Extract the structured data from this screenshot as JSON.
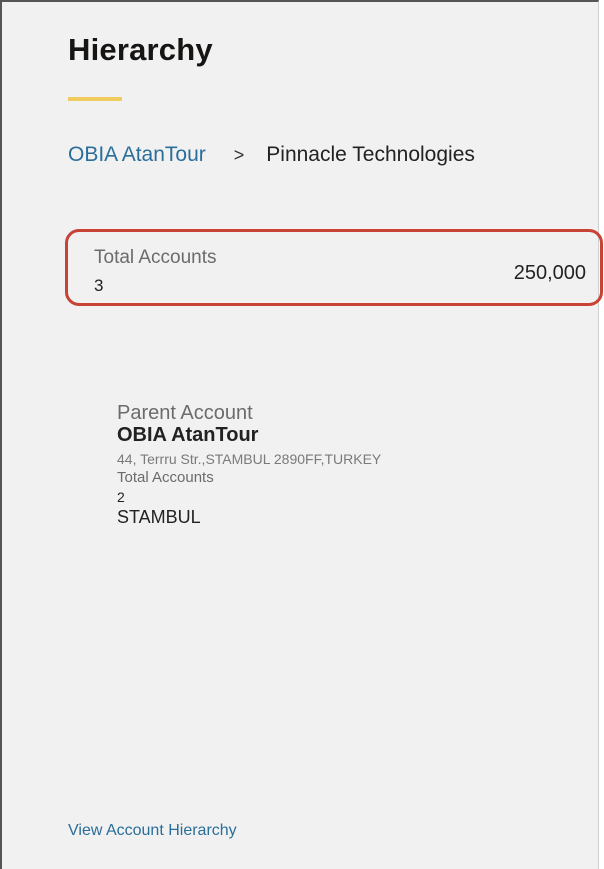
{
  "panel": {
    "title": "Hierarchy"
  },
  "breadcrumb": {
    "parent": "OBIA AtanTour",
    "separator": ">",
    "current": "Pinnacle Technologies"
  },
  "summary": {
    "total_accounts_label": "Total Accounts",
    "total_accounts_count": "3",
    "value": "250,000"
  },
  "parent_account": {
    "heading": "Parent Account",
    "name": "OBIA AtanTour",
    "address": "44, Terrru Str.,STAMBUL 2890FF,TURKEY",
    "total_accounts_label": "Total Accounts",
    "total_accounts_count": "2",
    "city": "STAMBUL"
  },
  "footer": {
    "view_hierarchy_link": "View Account Hierarchy"
  },
  "colors": {
    "link": "#2a6e9a",
    "accent_underline": "#f0cc5e",
    "highlight_border": "#c84235",
    "panel_background": "#f1f1f1"
  }
}
